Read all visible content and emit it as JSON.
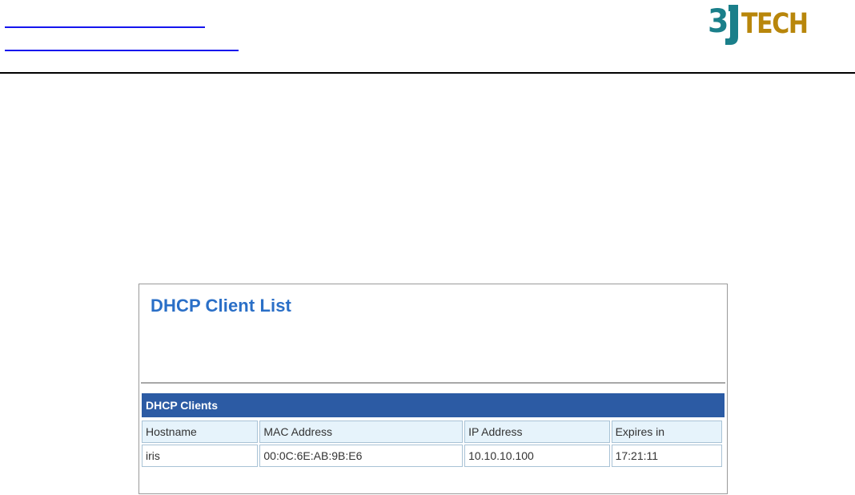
{
  "header": {
    "logo": {
      "text": "3JTECH",
      "colors": {
        "three": "#1a7f8a",
        "tech": "#b8860b"
      }
    }
  },
  "dhcp": {
    "title": "DHCP Client List",
    "section_label": "DHCP Clients",
    "columns": [
      "Hostname",
      "MAC Address",
      "IP Address",
      "Expires in"
    ],
    "rows": [
      {
        "hostname": "iris",
        "mac": "00:0C:6E:AB:9B:E6",
        "ip": "10.10.10.100",
        "expires": "17:21:11"
      }
    ]
  },
  "colors": {
    "title": "#2a6fc7",
    "section_bar": "#2c5ba4",
    "header_cell": "#e6f3fb",
    "link": "#1515ee"
  }
}
